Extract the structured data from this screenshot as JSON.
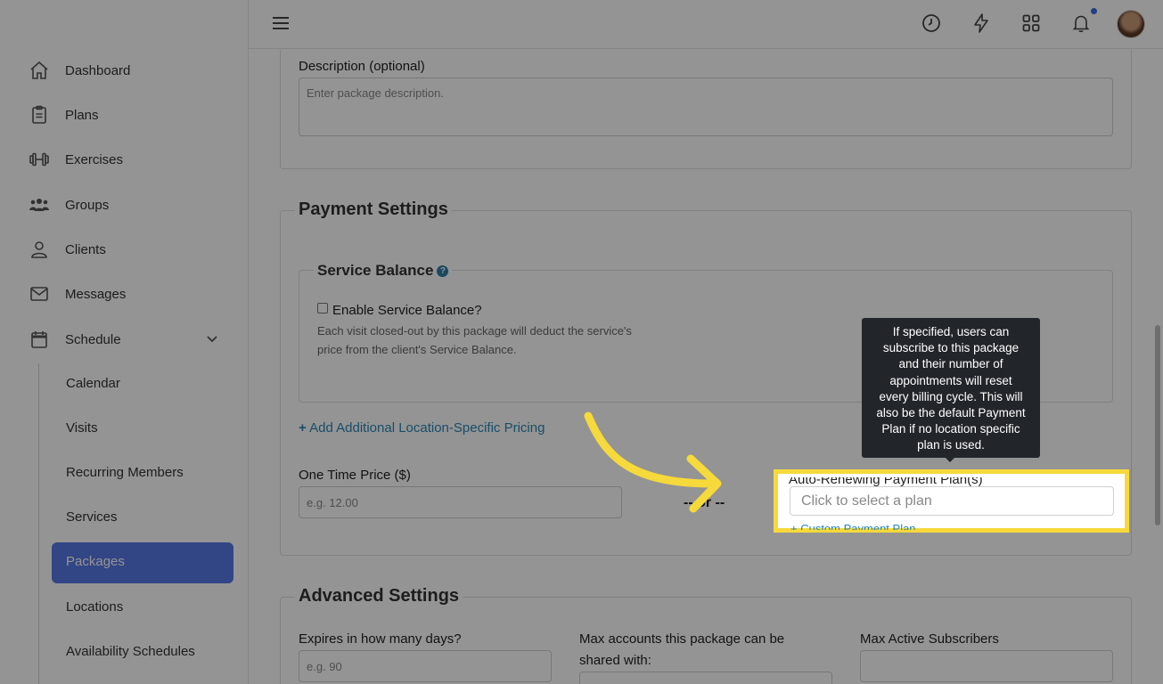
{
  "sidebar": {
    "items": [
      {
        "label": "Dashboard",
        "icon": "home-icon"
      },
      {
        "label": "Plans",
        "icon": "clipboard-icon"
      },
      {
        "label": "Exercises",
        "icon": "dumbbell-icon"
      },
      {
        "label": "Groups",
        "icon": "group-icon"
      },
      {
        "label": "Clients",
        "icon": "user-icon"
      },
      {
        "label": "Messages",
        "icon": "mail-icon"
      },
      {
        "label": "Schedule",
        "icon": "calendar-icon"
      }
    ],
    "schedule_sub": [
      "Calendar",
      "Visits",
      "Recurring Members",
      "Services",
      "Packages",
      "Locations",
      "Availability Schedules"
    ]
  },
  "description": {
    "label": "Description (optional)",
    "placeholder": "Enter package description."
  },
  "payment": {
    "title": "Payment Settings",
    "service_balance": {
      "title": "Service Balance",
      "help": "?",
      "checkbox_label": "Enable Service Balance?",
      "help_text_1": "Each visit closed-out by this package will deduct the service's",
      "help_text_2": "price from the client's Service Balance."
    },
    "add_location_link": "Add Additional Location-Specific Pricing",
    "one_time_label": "One Time Price ($)",
    "one_time_placeholder": "e.g. 12.00",
    "or_text": "-- or --",
    "auto_label": "Auto-Renewing Payment Plan(s)",
    "auto_placeholder": "Click to select a plan",
    "custom_link": "+ Custom Payment Plan"
  },
  "tooltip": {
    "lines": [
      "If specified, users can",
      "subscribe to this package",
      "and their number of",
      "appointments will reset",
      "every billing cycle. This will",
      "also be the default Payment",
      "Plan if no location specific",
      "plan is used."
    ]
  },
  "advanced": {
    "title": "Advanced Settings",
    "expires_label": "Expires in how many days?",
    "expires_placeholder": "e.g. 90",
    "max_accounts_label_1": "Max accounts this package can be",
    "max_accounts_label_2": "shared with:",
    "max_subscribers_label": "Max Active Subscribers"
  },
  "colors": {
    "accent": "#5778e6",
    "highlight": "#f6d93b",
    "link": "#2c86b5"
  }
}
